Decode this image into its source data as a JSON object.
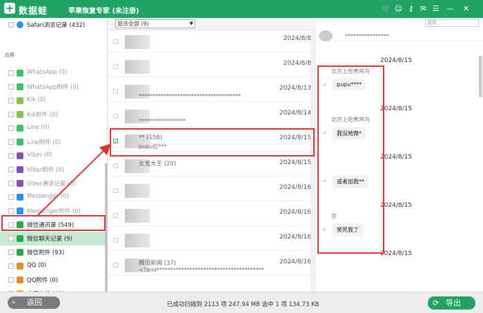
{
  "titlebar": {
    "brand": "数据蛙",
    "title": "苹果恢复专家 (未注册)"
  },
  "sidebar": {
    "safari": "Safari浏览记录 (432)",
    "section": "应用",
    "items": [
      {
        "label": "WhatsApp (0)",
        "color": "#3bc16b"
      },
      {
        "label": "WhatsApp附件 (0)",
        "color": "#3bc16b"
      },
      {
        "label": "Kik (0)",
        "color": "#88c152"
      },
      {
        "label": "Kik附件 (0)",
        "color": "#88c152"
      },
      {
        "label": "Line (0)",
        "color": "#3bc16b"
      },
      {
        "label": "Line附件 (0)",
        "color": "#3bc16b"
      },
      {
        "label": "Viber (0)",
        "color": "#7d56b9"
      },
      {
        "label": "Viber附件 (0)",
        "color": "#7d56b9"
      },
      {
        "label": "Viber通话记录 (0)",
        "color": "#7d56b9"
      },
      {
        "label": "Messenger (0)",
        "color": "#2d8ff0"
      },
      {
        "label": "Messenger附件 (0)",
        "color": "#2d8ff0"
      },
      {
        "label": "微信通讯录 (549)",
        "color": "#2aa84a"
      },
      {
        "label": "微信聊天记录 (9)",
        "color": "#2aa84a"
      },
      {
        "label": "微信附件 (93)",
        "color": "#2aa84a"
      },
      {
        "label": "QQ (0)",
        "color": "#e28f2a"
      },
      {
        "label": "QQ附件 (0)",
        "color": "#e28f2a"
      },
      {
        "label": "应用文档 (41)",
        "color": "#f0b400"
      }
    ]
  },
  "mid": {
    "filter": "显示全部 (9)",
    "rows": [
      {
        "name": "",
        "snippet": "",
        "date": "2024/8/8"
      },
      {
        "name": "",
        "snippet": "",
        "date": "2024/8/8"
      },
      {
        "name": "",
        "snippet": "*************************************",
        "date": "2024/8/13"
      },
      {
        "name": "",
        "snippet": "*****************",
        "date": "2024/8/14"
      },
      {
        "name": "** (158)",
        "snippet": "pupu拉***",
        "date": "2024/8/15"
      },
      {
        "name": "女鬼大王 (20)",
        "snippet": "",
        "date": "2024/8/15"
      },
      {
        "name": "",
        "snippet": "",
        "date": "2024/8/16"
      },
      {
        "name": "",
        "snippet": "",
        "date": "2024/8/16"
      },
      {
        "name": "",
        "snippet": "",
        "date": "2024/8/16"
      },
      {
        "name": "腾讯新闻 (37)",
        "snippet": "<?xml***************************************",
        "date": "2024/8/16"
      }
    ]
  },
  "chat": {
    "search": "搜索",
    "title": "****************",
    "messages": [
      {
        "date": "2024/8/15",
        "sender": "北京上吃煮鸡鸟",
        "text": "pupu****"
      },
      {
        "date": "2024/8/15",
        "sender": "北京上吃煮鸡鸟",
        "text": "我没她微*"
      },
      {
        "date": "2024/8/15",
        "sender": "",
        "text": "或者加我**"
      },
      {
        "date": "2024/8/15",
        "sender": "余",
        "text": "笑死我了"
      },
      {
        "date": "2024/8/15",
        "sender": "",
        "text": ""
      }
    ]
  },
  "footer": {
    "back": "返回",
    "status": "已成功扫描到 2113 项 247.94 MB   选中 1 项 134.73 KB",
    "export": "导出"
  },
  "colors": {
    "brand": "#21a363",
    "annotation": "#d83434"
  }
}
